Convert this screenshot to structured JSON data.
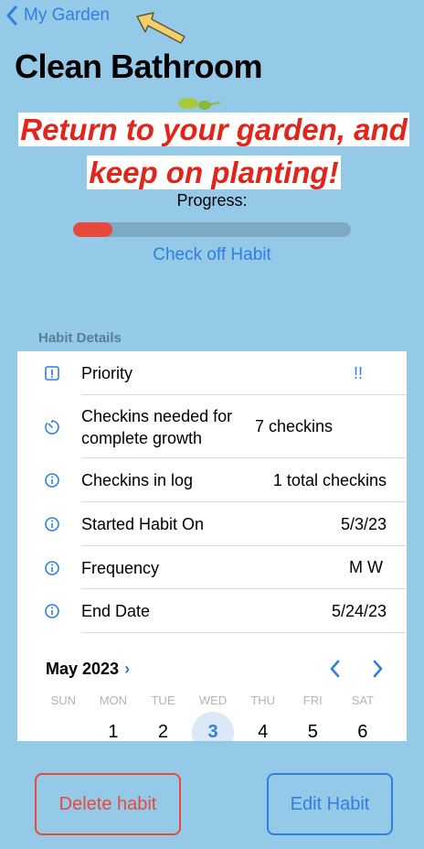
{
  "nav": {
    "back_label": "My Garden"
  },
  "header": {
    "title": "Clean Bathroom"
  },
  "banner": {
    "line1": "Return to your garden, and",
    "line2": "keep on planting!"
  },
  "progress": {
    "label": "Progress:",
    "value_fraction": 0.14
  },
  "actions": {
    "check_off": "Check off Habit",
    "delete": "Delete habit",
    "edit": "Edit Habit"
  },
  "details": {
    "header": "Habit Details",
    "rows": [
      {
        "label": "Priority",
        "value": "!!",
        "icon": "exclamation-square-icon"
      },
      {
        "label": "Checkins needed for complete growth",
        "value": "7 checkins",
        "icon": "timer-icon"
      },
      {
        "label": "Checkins in log",
        "value": "1 total checkins",
        "icon": "info-icon"
      },
      {
        "label": "Started Habit On",
        "value": "5/3/23",
        "icon": "info-icon"
      },
      {
        "label": "Frequency",
        "value": "M W",
        "icon": "info-icon"
      },
      {
        "label": "End Date",
        "value": "5/24/23",
        "icon": "info-icon"
      }
    ]
  },
  "calendar": {
    "month": "May 2023",
    "weekdays": [
      "SUN",
      "MON",
      "TUE",
      "WED",
      "THU",
      "FRI",
      "SAT"
    ],
    "days": [
      "",
      "1",
      "2",
      "3",
      "4",
      "5",
      "6"
    ],
    "selected_day": "3"
  },
  "colors": {
    "background": "#95c9e8",
    "accent": "#2f7fe0",
    "danger": "#e8493c",
    "banner_text": "#e1251b"
  }
}
